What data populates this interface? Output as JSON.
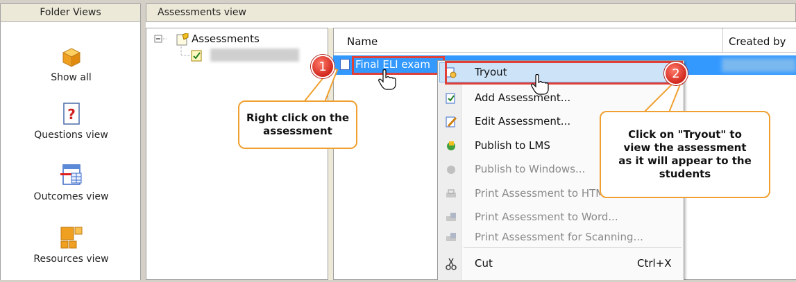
{
  "folder_views": {
    "header": "Folder Views",
    "items": [
      {
        "label": "Show all",
        "icon": "box-icon"
      },
      {
        "label": "Questions view",
        "icon": "question-icon"
      },
      {
        "label": "Outcomes view",
        "icon": "outcomes-icon"
      },
      {
        "label": "Resources view",
        "icon": "resources-icon"
      }
    ]
  },
  "assessments_view": {
    "header": "Assessments view",
    "tree": {
      "root": "Assessments"
    },
    "list": {
      "columns": [
        "Name",
        "Created by"
      ],
      "selected_row": "Final ELI exam"
    }
  },
  "context_menu": {
    "items": [
      {
        "label": "Tryout",
        "disabled": false
      },
      {
        "label": "Add Assessment...",
        "disabled": false
      },
      {
        "label": "Edit Assessment...",
        "disabled": false
      },
      {
        "label": "Publish to LMS",
        "disabled": false
      },
      {
        "label": "Publish to Windows...",
        "disabled": true
      },
      {
        "label": "Print Assessment to HTML...",
        "disabled": true
      },
      {
        "label": "Print Assessment to Word...",
        "disabled": true
      },
      {
        "label": "Print Assessment for Scanning...",
        "disabled": true
      },
      {
        "label": "Cut",
        "shortcut": "Ctrl+X",
        "disabled": false
      }
    ]
  },
  "callouts": {
    "step1": {
      "number": "1",
      "text": "Right click on the assessment"
    },
    "step2": {
      "number": "2",
      "text": "Click on \"Tryout\" to view the assessment as it will appear to the students"
    }
  },
  "colors": {
    "selection": "#3399ff",
    "highlight_box": "#e0403a",
    "callout_border": "#f0a030",
    "badge": "#d2281e"
  }
}
